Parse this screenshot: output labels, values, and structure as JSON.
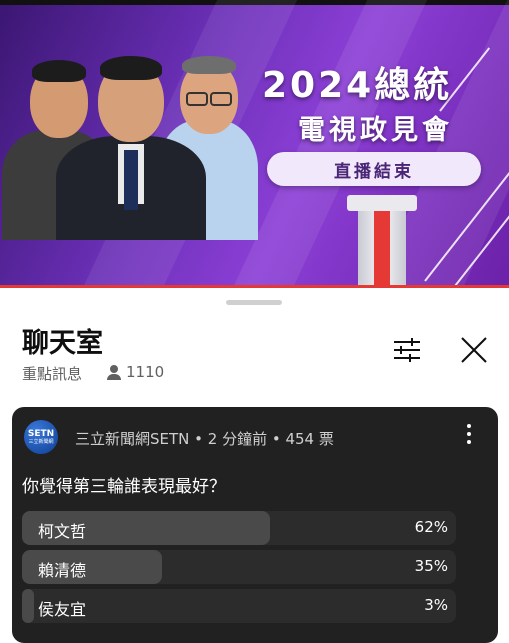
{
  "video": {
    "title_line1": "2024總統",
    "title_line2": "電視政見會",
    "status_pill": "直播結束"
  },
  "chat": {
    "title": "聊天室",
    "mode_label": "重點訊息",
    "viewer_count": "1110",
    "icons": {
      "filter": "tune-icon",
      "close": "close-icon"
    }
  },
  "poll": {
    "avatar_text": "SETN",
    "avatar_subtext": "三立新聞網",
    "meta": "三立新聞網SETN • 2 分鐘前 • 454 票",
    "question": "你覺得第三輪誰表現最好？",
    "options": [
      {
        "label": "柯文哲",
        "percent_text": "62%",
        "percent": 62
      },
      {
        "label": "賴清德",
        "percent_text": "35%",
        "percent": 35
      },
      {
        "label": "侯友宜",
        "percent_text": "3%",
        "percent": 3
      }
    ]
  },
  "colors": {
    "banner_purple": "#6a2fb6",
    "poll_bg": "#212121",
    "bar_fill": "#4a4a4a",
    "accent_red": "#e53935"
  }
}
